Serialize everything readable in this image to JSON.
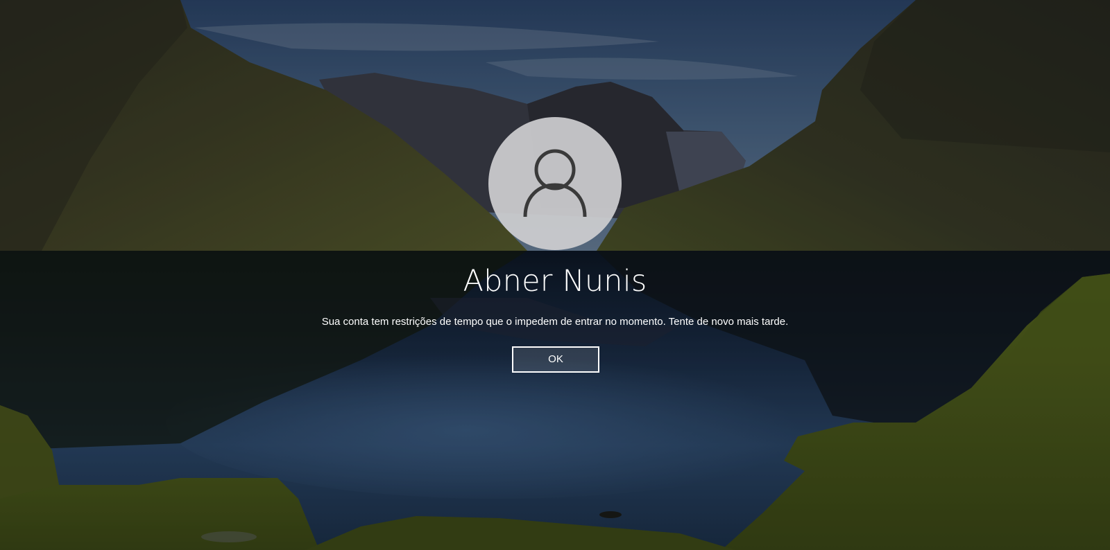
{
  "lock_screen": {
    "user_name": "Abner Nunis",
    "message": "Sua conta tem restrições de tempo que o impedem de entrar no momento. Tente de novo mais tarde.",
    "ok_label": "OK",
    "avatar_icon": "user-silhouette-icon",
    "background_image": "fjord-lake-mountains-landscape",
    "colors": {
      "avatar_bg": "#cdcdd0",
      "avatar_icon": "#3a3a3a",
      "text": "#ffffff",
      "button_border": "#ffffff"
    }
  }
}
